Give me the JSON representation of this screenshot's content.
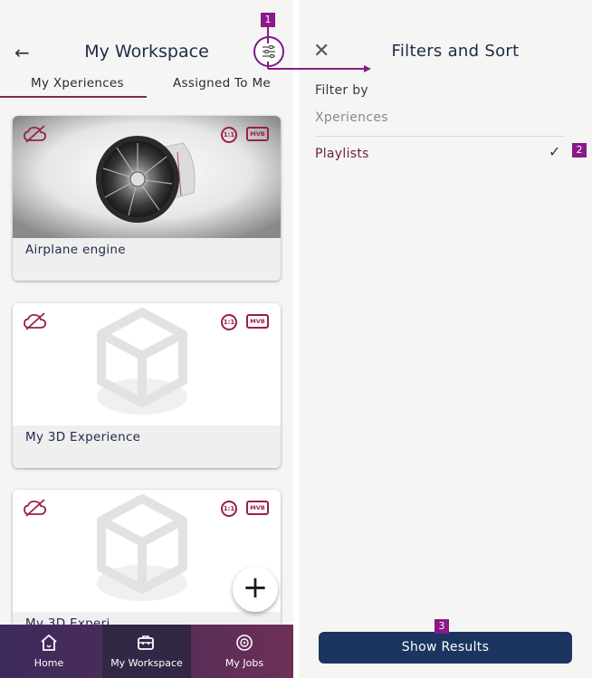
{
  "header": {
    "title": "My Workspace",
    "tabs": [
      {
        "label": "My Xperiences",
        "active": true
      },
      {
        "label": "Assigned To Me",
        "active": false
      }
    ]
  },
  "cards": [
    {
      "label": "Airplane engine"
    },
    {
      "label": "My 3D Experience"
    },
    {
      "label": "My 3D Experi..."
    }
  ],
  "badges": {
    "ratio": "1:1",
    "mvb": "MVB"
  },
  "fab": {
    "label": "+"
  },
  "bottom_nav": [
    {
      "label": "Home",
      "icon": "home-icon",
      "active": false
    },
    {
      "label": "My Workspace",
      "icon": "toolbox-icon",
      "active": true
    },
    {
      "label": "My Jobs",
      "icon": "jobs-icon",
      "active": false
    }
  ],
  "filters": {
    "title": "Filters and Sort",
    "section": "Filter by",
    "options": [
      {
        "label": "Xperiences",
        "selected": false
      },
      {
        "label": "Playlists",
        "selected": true
      }
    ],
    "show_results": "Show Results"
  },
  "callouts": [
    "1",
    "2",
    "3"
  ],
  "colors": {
    "accent": "#7a1a8a",
    "primary_button": "#1b3560",
    "nav_bg": "#6b2f55",
    "selected_text": "#6a1f45"
  }
}
